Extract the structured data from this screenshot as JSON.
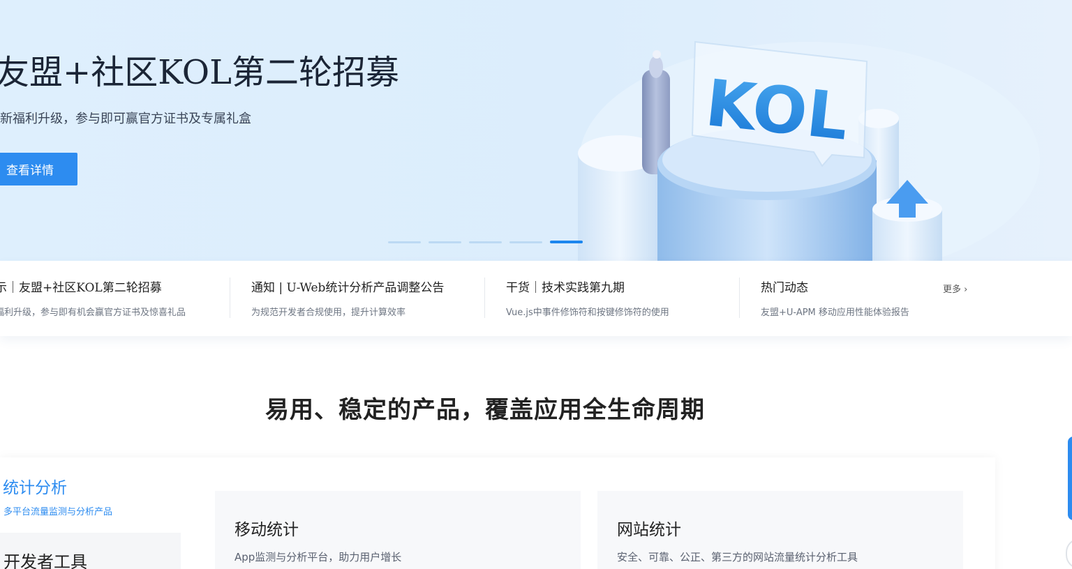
{
  "hero": {
    "title": "友盟+社区KOL第二轮招募",
    "subtitle": "新福利升级，参与即可赢官方证书及专属礼盒",
    "cta_label": "查看详情",
    "art_text": "KOL",
    "slide_count": 5,
    "active_slide": 5
  },
  "news": {
    "items": [
      {
        "title": "示｜友盟+社区KOL第二轮招募",
        "desc": "福利升级，参与即有机会赢官方证书及惊喜礼品"
      },
      {
        "title": "通知 | U-Web统计分析产品调整公告",
        "desc": "为规范开发者合规使用，提升计算效率"
      },
      {
        "title": "干货｜技术实践第九期",
        "desc": "Vue.js中事件修饰符和按键修饰符的使用"
      },
      {
        "title": "热门动态",
        "desc": "友盟+U-APM 移动应用性能体验报告"
      }
    ],
    "more_label": "更多 ›"
  },
  "products": {
    "section_title": "易用、稳定的产品，覆盖应用全生命周期",
    "categories": [
      {
        "title": "统计分析",
        "desc": "多平台流量监测与分析产品"
      },
      {
        "title": "开发者工具"
      }
    ],
    "cards": [
      {
        "title": "移动统计",
        "desc": "App监测与分析平台，助力用户增长"
      },
      {
        "title": "网站统计",
        "desc": "安全、可靠、公正、第三方的网站流量统计分析工具"
      }
    ]
  },
  "colors": {
    "accent": "#2d8cf0",
    "hero_bg": "#deeffd",
    "card_bg": "#f7f8fa"
  }
}
